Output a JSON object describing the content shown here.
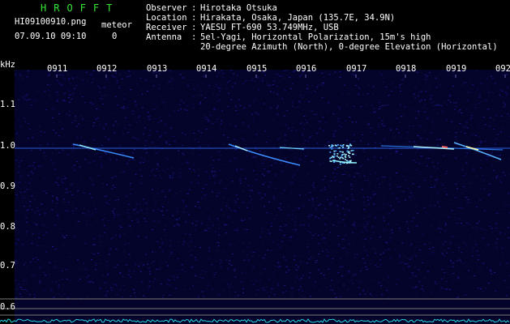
{
  "brand": {
    "text": "HROFFT",
    "color": "#33e633"
  },
  "file": {
    "name": "HI09100910.png",
    "datetime": "07.09.10 09:10"
  },
  "meteor": {
    "label": "meteor",
    "count": "0"
  },
  "info": {
    "observer_key": "Observer",
    "observer_val": "Hirotaka Otsuka",
    "location_key": "Location",
    "location_val": "Hirakata, Osaka, Japan (135.7E, 34.9N)",
    "receiver_key": "Receiver",
    "receiver_val": "YAESU FT-690 53.749MHz, USB",
    "antenna_key": "Antenna",
    "antenna_val": "5el-Yagi, Horizontal Polarization, 15m's high",
    "antenna_val2": "20-degree Azimuth (North), 0-degree Elevation (Horizontal)",
    "sep": ":"
  },
  "axis": {
    "unit": "kHz",
    "y_ticks": [
      "1.1",
      "1.0",
      "0.9",
      "0.8",
      "0.7",
      "0.6"
    ],
    "x_ticks": [
      "0911",
      "0912",
      "0913",
      "0914",
      "0915",
      "0916",
      "0917",
      "0918",
      "0919",
      "092"
    ]
  },
  "colors": {
    "text": "#ffffff",
    "tick": "#c8c8ff",
    "background": "#000000",
    "spectrum": "#0a0a50",
    "carrier": "#3399ff"
  }
}
